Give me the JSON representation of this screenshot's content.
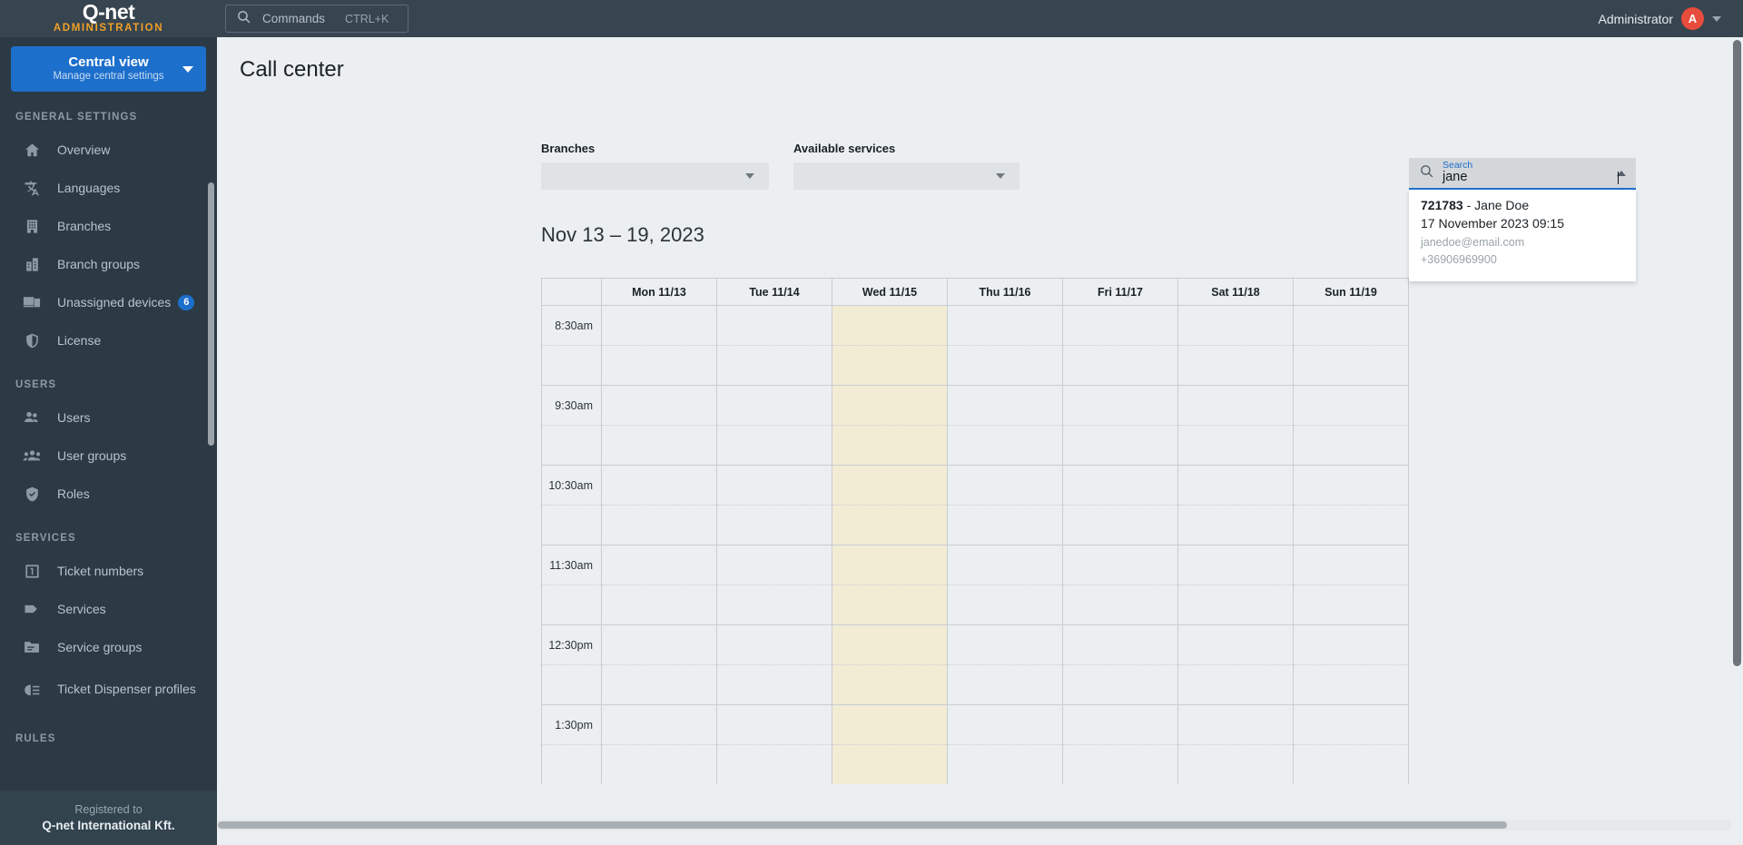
{
  "brand": {
    "logo": "Q-net",
    "subtitle": "ADMINISTRATION"
  },
  "topbar": {
    "commands_label": "Commands",
    "commands_shortcut": "CTRL+K",
    "search_icon": "search-icon",
    "user_name": "Administrator",
    "avatar_initial": "A",
    "caret_icon": "chevron-down-icon"
  },
  "view_switch": {
    "title": "Central view",
    "subtitle": "Manage central settings",
    "caret_icon": "chevron-down-icon"
  },
  "sidebar": {
    "sections": [
      {
        "title": "GENERAL SETTINGS",
        "items": [
          {
            "label": "Overview",
            "icon": "home-icon",
            "badge": null
          },
          {
            "label": "Languages",
            "icon": "translate-icon",
            "badge": null
          },
          {
            "label": "Branches",
            "icon": "building-icon",
            "badge": null
          },
          {
            "label": "Branch groups",
            "icon": "buildings-icon",
            "badge": null
          },
          {
            "label": "Unassigned devices",
            "icon": "devices-icon",
            "badge": "6"
          },
          {
            "label": "License",
            "icon": "shield-icon",
            "badge": null
          }
        ]
      },
      {
        "title": "USERS",
        "items": [
          {
            "label": "Users",
            "icon": "users-icon",
            "badge": null
          },
          {
            "label": "User groups",
            "icon": "user-group-icon",
            "badge": null
          },
          {
            "label": "Roles",
            "icon": "shield-check-icon",
            "badge": null
          }
        ]
      },
      {
        "title": "SERVICES",
        "items": [
          {
            "label": "Ticket numbers",
            "icon": "ticket-number-icon",
            "badge": null
          },
          {
            "label": "Services",
            "icon": "tag-icon",
            "badge": null
          },
          {
            "label": "Service groups",
            "icon": "folder-icon",
            "badge": null
          },
          {
            "label": "Ticket Dispenser profiles",
            "icon": "dispenser-icon",
            "badge": null
          }
        ]
      },
      {
        "title": "RULES",
        "items": []
      }
    ],
    "footer": {
      "registered_label": "Registered to",
      "organization": "Q-net International Kft."
    }
  },
  "main": {
    "page_title": "Call center",
    "filters": [
      {
        "label": "Branches",
        "value": "",
        "caret_icon": "chevron-down-icon"
      },
      {
        "label": "Available services",
        "value": "",
        "caret_icon": "chevron-down-icon"
      }
    ],
    "date_range": "Nov 13 – 19, 2023"
  },
  "search": {
    "float_label": "Search",
    "value": "jane",
    "search_icon": "search-icon",
    "caret_icon": "chevron-up-icon",
    "results": [
      {
        "id": "721783",
        "separator": " - ",
        "name": "Jane Doe",
        "datetime": "17 November 2023 09:15",
        "email": "janedoe@email.com",
        "phone": "+36906969900"
      }
    ]
  },
  "calendar": {
    "days": [
      {
        "label": "Mon 11/13",
        "today": false
      },
      {
        "label": "Tue 11/14",
        "today": false
      },
      {
        "label": "Wed 11/15",
        "today": true
      },
      {
        "label": "Thu 11/16",
        "today": false
      },
      {
        "label": "Fri 11/17",
        "today": false
      },
      {
        "label": "Sat 11/18",
        "today": false
      },
      {
        "label": "Sun 11/19",
        "today": false
      }
    ],
    "time_slots": [
      "8:30am",
      "9:30am",
      "10:30am",
      "11:30am",
      "12:30pm",
      "1:30pm"
    ],
    "events": []
  },
  "colors": {
    "sidebar_bg": "#2c3a45",
    "topbar_bg": "#374550",
    "accent_blue": "#1d6fcc",
    "brand_orange": "#f0a025",
    "avatar_red": "#e74c3c",
    "today_highlight": "#f2ecd5",
    "page_bg": "#eceff1"
  }
}
